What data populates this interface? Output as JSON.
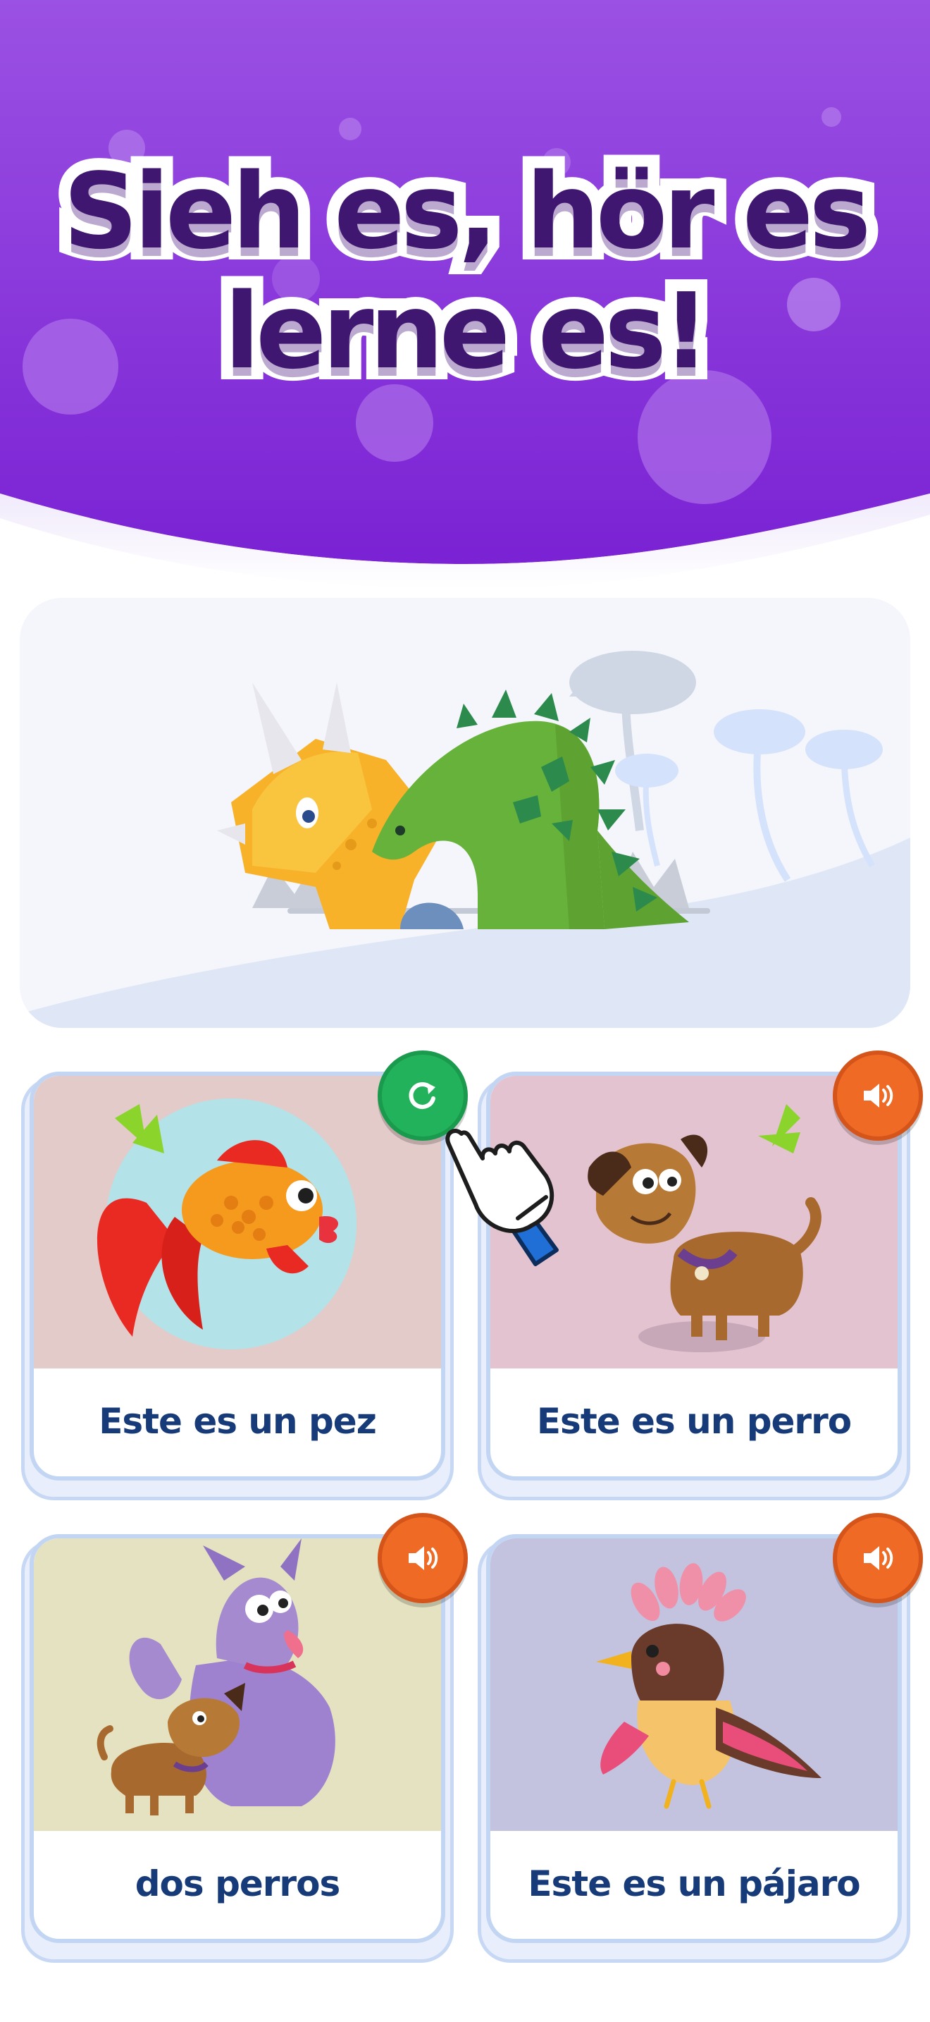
{
  "headline": {
    "line1": "Sieh es, hör es",
    "line2": "lerne es!"
  },
  "hero": {
    "illustration": "dinosaurs-triceratops-and-stegosaurus"
  },
  "cards": [
    {
      "caption": "Este es un pez",
      "image": "goldfish",
      "button_icon": "replay-icon",
      "background": "#e3cbc9"
    },
    {
      "caption": "Este es un perro",
      "image": "dog",
      "button_icon": "speaker-icon",
      "background": "#e3c3cf"
    },
    {
      "caption": "dos perros",
      "image": "wolf-and-dog",
      "button_icon": "speaker-icon",
      "background": "#e4e2c1"
    },
    {
      "caption": "Este es un pájaro",
      "image": "bird",
      "button_icon": "speaker-icon",
      "background": "#c3c3e0"
    }
  ],
  "colors": {
    "header_purple": "#8a36de",
    "headline_text": "#3f1670",
    "caption_text": "#173a78",
    "sound_button": "#ef6a25",
    "replay_button": "#23b25c"
  }
}
